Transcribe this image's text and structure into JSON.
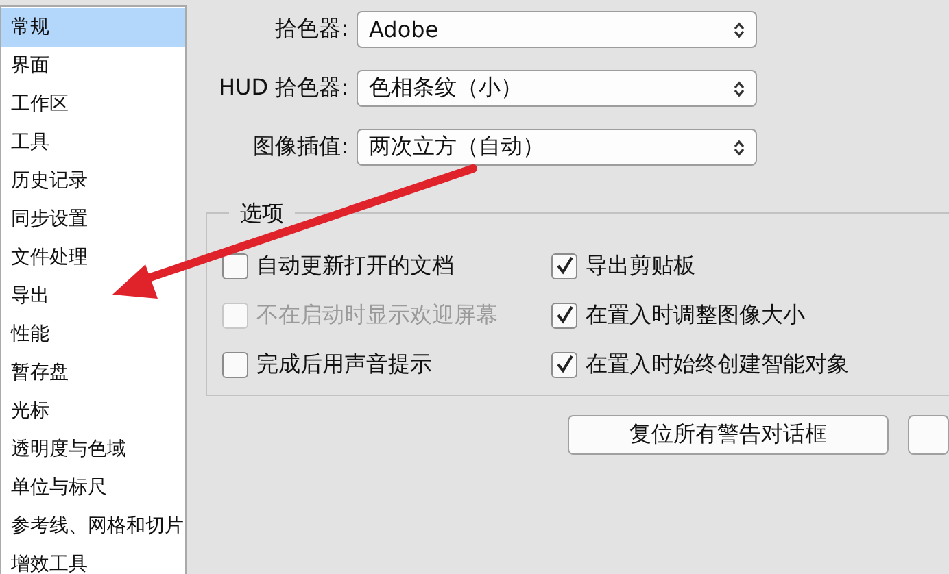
{
  "sidebar": {
    "items": [
      {
        "label": "常规",
        "selected": true
      },
      {
        "label": "界面",
        "selected": false
      },
      {
        "label": "工作区",
        "selected": false
      },
      {
        "label": "工具",
        "selected": false
      },
      {
        "label": "历史记录",
        "selected": false
      },
      {
        "label": "同步设置",
        "selected": false
      },
      {
        "label": "文件处理",
        "selected": false
      },
      {
        "label": "导出",
        "selected": false
      },
      {
        "label": "性能",
        "selected": false
      },
      {
        "label": "暂存盘",
        "selected": false
      },
      {
        "label": "光标",
        "selected": false
      },
      {
        "label": "透明度与色域",
        "selected": false
      },
      {
        "label": "单位与标尺",
        "selected": false
      },
      {
        "label": "参考线、网格和切片",
        "selected": false
      },
      {
        "label": "增效工具",
        "selected": false
      }
    ]
  },
  "fields": [
    {
      "label": "拾色器:",
      "value": "Adobe"
    },
    {
      "label": "HUD 拾色器:",
      "value": "色相条纹（小）"
    },
    {
      "label": "图像插值:",
      "value": "两次立方（自动）"
    }
  ],
  "options": {
    "title": "选项",
    "items": [
      {
        "label": "自动更新打开的文档",
        "checked": false,
        "disabled": false
      },
      {
        "label": "导出剪贴板",
        "checked": true,
        "disabled": false
      },
      {
        "label": "不在启动时显示欢迎屏幕",
        "checked": false,
        "disabled": true
      },
      {
        "label": "在置入时调整图像大小",
        "checked": true,
        "disabled": false
      },
      {
        "label": "完成后用声音提示",
        "checked": false,
        "disabled": false
      },
      {
        "label": "在置入时始终创建智能对象",
        "checked": true,
        "disabled": false
      }
    ]
  },
  "buttons": [
    "复位所有警告对话框"
  ]
}
